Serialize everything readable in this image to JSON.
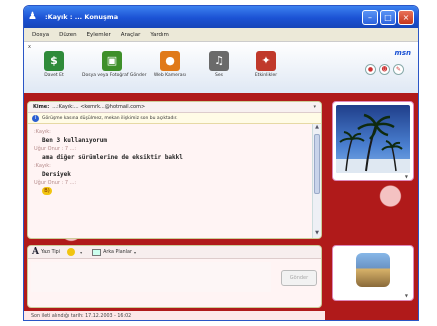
{
  "window": {
    "title": ":Kayık : ... Konuşma"
  },
  "menu": {
    "items": [
      "Dosya",
      "Düzen",
      "Eylemler",
      "Araçlar",
      "Yardım"
    ]
  },
  "toolbar": {
    "close_label": "x",
    "buttons": [
      {
        "label": "Davet Et",
        "icon": "invite-person-icon",
        "color": "#2f8b3a"
      },
      {
        "label": "Dosya veya Fotoğraf Gönder",
        "icon": "send-file-icon",
        "color": "#3e8f2a"
      },
      {
        "label": "Web Kamerası",
        "icon": "webcam-icon",
        "color": "#e07a1a"
      },
      {
        "label": "Ses",
        "icon": "voice-icon",
        "color": "#6a6a6a"
      },
      {
        "label": "Etkinlikler",
        "icon": "activities-icon",
        "color": "#c0392b"
      }
    ],
    "logo": "msn"
  },
  "conversation": {
    "to_label": "Kime:",
    "to_value": "...:Kayık:... <kemrk...@hotmail.com>",
    "info_text": "Görüşme kasına düşülmez, mekan ilişkimiz son bu açıktadır.",
    "messages": [
      {
        "sender": ":Kayık:",
        "text": "Ben 3 kullanıyorum"
      },
      {
        "sender": "Uğur Onur : 7 ...:",
        "text": "ama diğer sürümlerine de eksiktir bakkl"
      },
      {
        "sender": ":Kayık:",
        "text": "Dersiyek"
      },
      {
        "sender": "Uğur Onur : 7 ...:",
        "text": "",
        "emoticon": "😎"
      }
    ]
  },
  "compose": {
    "font_label": "Yazı Tipi",
    "emoticon_label": "▾",
    "background_label": "Arka Planlar",
    "send_label": "Gönder"
  },
  "status": {
    "last_message": "Son ileti alındığı tarih: 17.12.2003 - 16:02"
  }
}
